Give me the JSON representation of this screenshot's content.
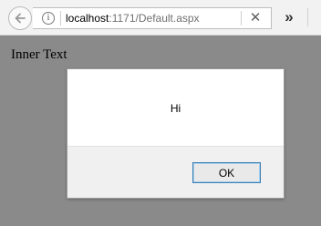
{
  "browser": {
    "url_host": "localhost",
    "url_rest": ":1171/Default.aspx",
    "icons": {
      "back": "back-arrow-icon",
      "info": "info-icon",
      "stop": "close-icon",
      "overflow": "chevron-double-right-icon"
    }
  },
  "page": {
    "body_text": "Inner Text"
  },
  "dialog": {
    "message": "Hi",
    "ok_label": "OK"
  },
  "colors": {
    "page_background": "#8a8a8a",
    "button_border": "#3c7fb1"
  }
}
